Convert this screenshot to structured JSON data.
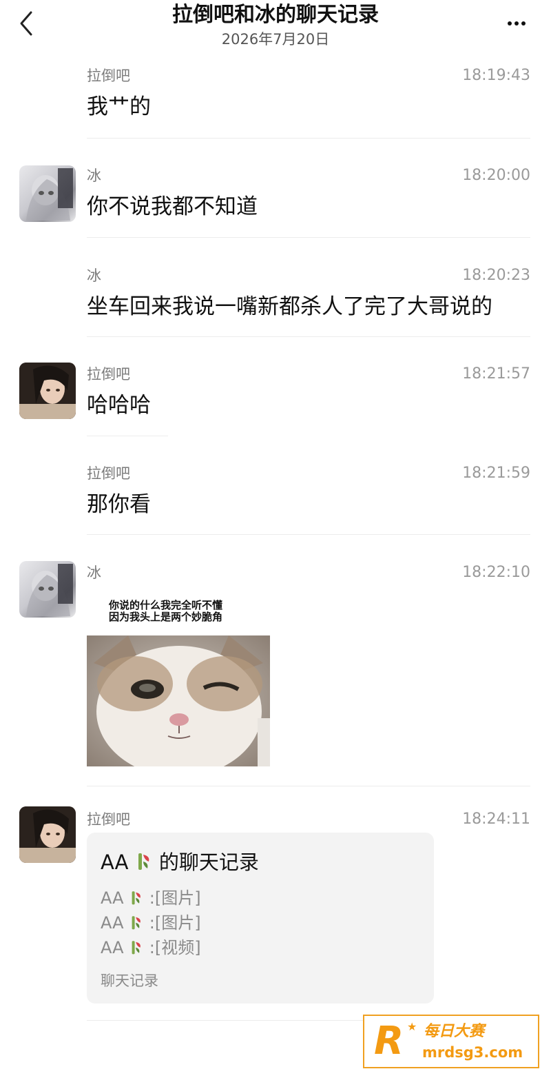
{
  "header": {
    "title": "拉倒吧和冰的聊天记录",
    "date": "2026年7月20日"
  },
  "messages": [
    {
      "sender": "拉倒吧",
      "time": "18:19:43",
      "text": "我艹的"
    },
    {
      "sender": "冰",
      "time": "18:20:00",
      "text": "你不说我都不知道"
    },
    {
      "sender": "冰",
      "time": "18:20:23",
      "text": "坐车回来我说一嘴新都杀人了完了大哥说的"
    },
    {
      "sender": "拉倒吧",
      "time": "18:21:57",
      "text": "哈哈哈"
    },
    {
      "sender": "拉倒吧",
      "time": "18:21:59",
      "text": "那你看"
    },
    {
      "sender": "冰",
      "time": "18:22:10",
      "sticker_caption": [
        "你说的什么我完全听不懂",
        "因为我头上是两个妙脆角"
      ]
    },
    {
      "sender": "拉倒吧",
      "time": "18:24:11",
      "card": {
        "title_prefix": "AA",
        "title_suffix": "的聊天记录",
        "lines": [
          {
            "name": "AA",
            "content": ":[图片]"
          },
          {
            "name": "AA",
            "content": ":[图片]"
          },
          {
            "name": "AA",
            "content": ":[视频]"
          }
        ],
        "footer": "聊天记录"
      }
    }
  ],
  "watermark": {
    "logo_letter": "R",
    "brand": "每日大赛",
    "url": "mrdsg3.com"
  },
  "colors": {
    "text_primary": "#111111",
    "text_secondary": "#7b7b7b",
    "time": "#9a9a9a",
    "divider": "#ececec",
    "card_bg": "#f3f3f3",
    "watermark_orange": "#f39a12"
  },
  "icons": {
    "back": "chevron-left-icon",
    "more": "ellipsis-icon",
    "card_emoji": "sprout-icon"
  }
}
